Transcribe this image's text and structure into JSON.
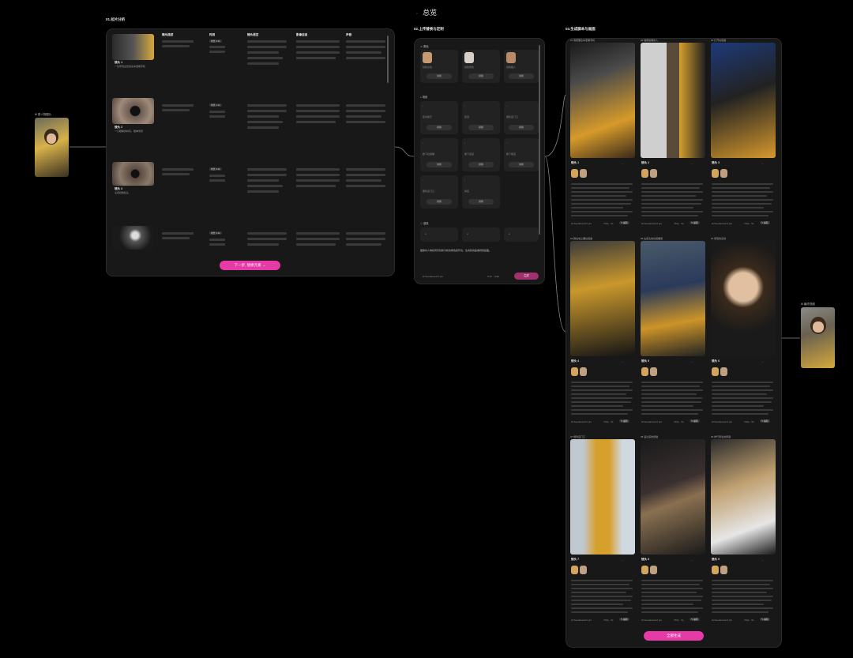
{
  "page_title": "总览",
  "sections": {
    "s1": "01.拉片分析",
    "s2": "02.上传替换与定制",
    "s3": "03.生成脚本与画面"
  },
  "left_image_label": "原人物图片",
  "right_image_label": "最终视频",
  "s1": {
    "columns": [
      "镜头描述",
      "时间",
      "镜头语言",
      "影像信息",
      "声音"
    ],
    "rows": [
      {
        "name": "镜头 1",
        "time": "时长 3.3s",
        "desc": "一位年轻女孩坐在车里看手机"
      },
      {
        "name": "镜头 2",
        "time": "时长 1.1s",
        "desc": "一只眼睛的特写，眼神紧张"
      },
      {
        "name": "镜头 3",
        "time": "时长 3.3s",
        "desc": "主观视角镜头"
      },
      {
        "name": "镜头 4",
        "time": "时长 3.3s",
        "desc": "夜晚街道的场景"
      }
    ],
    "next_button": "下一步, 替换元素 →"
  },
  "s2": {
    "groups": [
      {
        "title": "角色",
        "items": [
          "替换女性",
          "替换男性",
          "替换路人"
        ]
      },
      {
        "title": "场景",
        "items": [
          "室内客厅",
          "街道",
          "便利店门口",
          "楼下垃圾桶",
          "楼下街道",
          "楼下巷道",
          "便利店门口",
          "商店"
        ]
      },
      {
        "title": "道具",
        "items": [
          "",
          "",
          ""
        ]
      }
    ],
    "replace_label": "替换",
    "prompt_text": "图像将人物和场景替换为新的角色和环境，生成新的故事视频画面。",
    "model_label": "Seedance2.0 pro",
    "ratio_label": "9:16 · 720p",
    "generate_label": "生成"
  },
  "s3": {
    "shots": [
      {
        "label": "镜头 1",
        "header": "01 我想要在车里看手机"
      },
      {
        "label": "镜头 2",
        "header": "02 墙角偷看的人"
      },
      {
        "label": "镜头 3",
        "header": "03 打开垃圾袋"
      },
      {
        "label": "镜头 4",
        "header": "04 蹲在地上翻垃圾袋"
      },
      {
        "label": "镜头 5",
        "header": "05 在街头的垃圾桶旁"
      },
      {
        "label": "镜头 6",
        "header": "06 惊恐的表情"
      },
      {
        "label": "镜头 7",
        "header": "07 便利店门口"
      },
      {
        "label": "镜头 8",
        "header": "08 递过来的纸袋"
      },
      {
        "label": "镜头 9",
        "header": "09 帅气男生的笑容"
      }
    ],
    "model_label": "Seedance2.0 pro",
    "ratio_label": "720p · 5s",
    "edit_label": "编辑",
    "gen_all_label": "全部生成"
  },
  "colors": {
    "accent": "#e63aa7",
    "panel": "#181818",
    "background": "#000000"
  }
}
